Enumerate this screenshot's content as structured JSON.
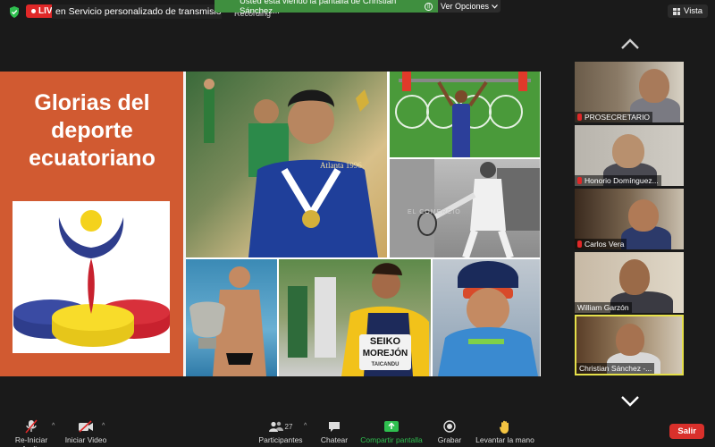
{
  "top_bar": {
    "live_label": "LIVE",
    "stream_title": "en Servicio personalizado de transmisión en vivo",
    "recording_label": "Recording",
    "banner_text": "Usted está viendo la pantalla de Christian Sánchez...",
    "options_label": "Ver Opciones",
    "view_label": "Vista"
  },
  "slide": {
    "title": "Glorias del deporte ecuatoriano",
    "olympic_text": "Atlanta 1996",
    "bib_brand": "SEIKO",
    "bib_name": "MOREJÓN",
    "bib_sub": "TAICANDU",
    "watermark": "EL COMERCIO"
  },
  "participants": [
    {
      "name": "PROSECRETARIO",
      "muted": true
    },
    {
      "name": "Honorio Domínguez...",
      "muted": true
    },
    {
      "name": "Carlos Vera",
      "muted": true
    },
    {
      "name": "William Garzón",
      "muted": false
    },
    {
      "name": "Christian Sánchez -...",
      "muted": false,
      "active": true
    }
  ],
  "toolbar": {
    "audio_label": "Re-Iniciar Audio",
    "video_label": "Iniciar Video",
    "participants_label": "Participantes",
    "participants_count": "27",
    "chat_label": "Chatear",
    "share_label": "Compartir pantalla",
    "record_label": "Grabar",
    "raise_hand_label": "Levantar la mano",
    "leave_label": "Salir"
  },
  "colors": {
    "live": "#e02828",
    "banner": "#3f8f3f",
    "slide_panel": "#d15a31",
    "active_speaker": "#e5e04a",
    "share": "#2fbf4f",
    "leave": "#d9302b"
  }
}
